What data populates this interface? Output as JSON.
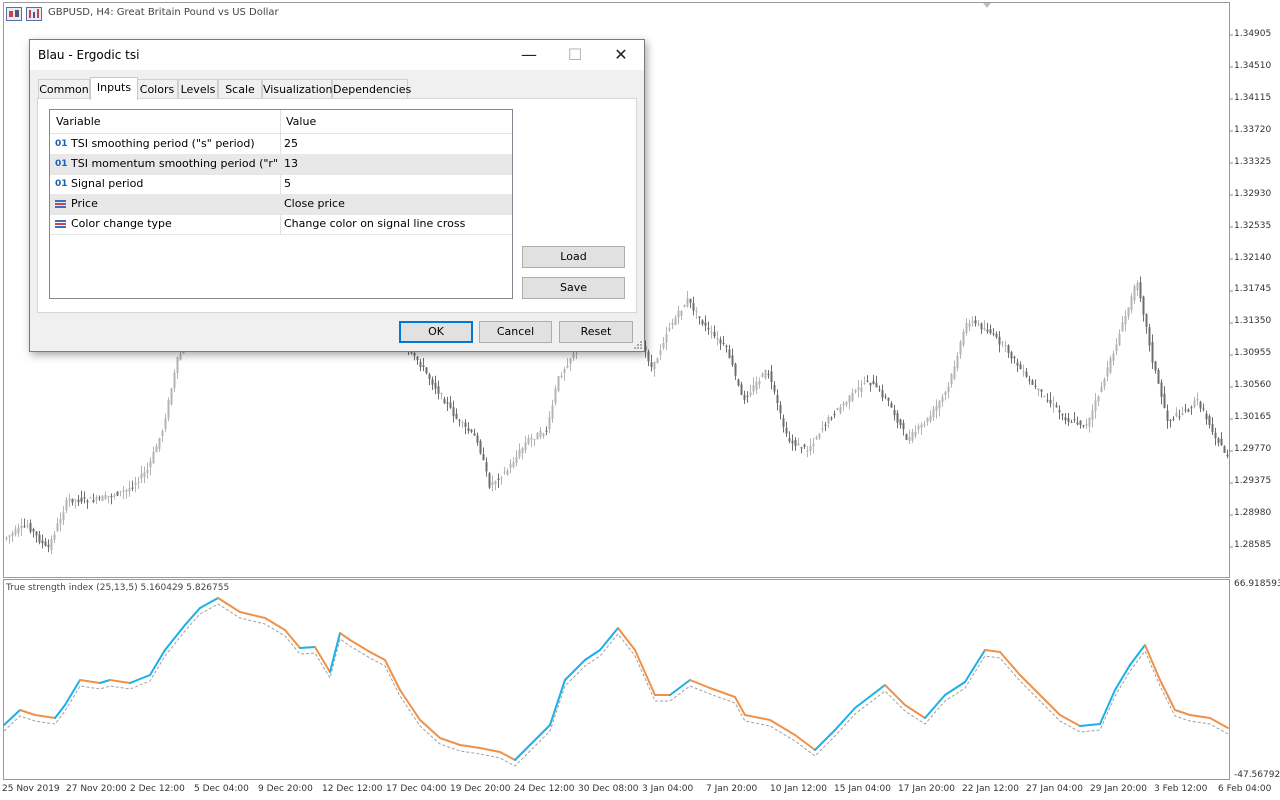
{
  "chart": {
    "symbol_title": "GBPUSD, H4:  Great Britain Pound vs US Dollar",
    "price_labels": [
      "1.34905",
      "1.34510",
      "1.34115",
      "1.33720",
      "1.33325",
      "1.32930",
      "1.32535",
      "1.32140",
      "1.31745",
      "1.31350",
      "1.30955",
      "1.30560",
      "1.30165",
      "1.29770",
      "1.29375",
      "1.28980",
      "1.28585"
    ],
    "indicator_title": "True strength index (25,13,5) 5.160429 5.826755",
    "indicator_max": "66.918593",
    "indicator_min": "-47.567920",
    "date_labels": [
      "25 Nov 2019",
      "27 Nov 20:00",
      "2 Dec 12:00",
      "5 Dec 04:00",
      "9 Dec 20:00",
      "12 Dec 12:00",
      "17 Dec 04:00",
      "19 Dec 20:00",
      "24 Dec 12:00",
      "30 Dec 08:00",
      "3 Jan 04:00",
      "7 Jan 20:00",
      "10 Jan 12:00",
      "15 Jan 04:00",
      "17 Jan 20:00",
      "22 Jan 12:00",
      "27 Jan 04:00",
      "29 Jan 20:00",
      "3 Feb 12:00",
      "6 Feb 04:00"
    ],
    "colors": {
      "tsi_up": "#1ab0e8",
      "tsi_down": "#f0914a",
      "signal": "#a0a0a0",
      "candle_bull": "#b4b4b4",
      "candle_bear": "#6e6e6e"
    }
  },
  "dialog": {
    "title": "Blau - Ergodic tsi",
    "window_buttons": {
      "minimize": "—",
      "maximize": "☐",
      "close": "✕"
    },
    "tabs": [
      "Common",
      "Inputs",
      "Colors",
      "Levels",
      "Scale",
      "Visualization",
      "Dependencies"
    ],
    "active_tab": "Inputs",
    "grid": {
      "headers": [
        "Variable",
        "Value"
      ],
      "rows": [
        {
          "type_icon": "01",
          "variable": "TSI smoothing period (\"s\" period)",
          "value": "25"
        },
        {
          "type_icon": "01",
          "variable": "TSI momentum smoothing period  (\"r\" pe...",
          "value": "13"
        },
        {
          "type_icon": "01",
          "variable": "Signal period",
          "value": "5"
        },
        {
          "type_icon": "enum",
          "variable": "Price",
          "value": "Close price"
        },
        {
          "type_icon": "enum",
          "variable": "Color change type",
          "value": "Change color on signal line cross"
        }
      ]
    },
    "buttons": {
      "load": "Load",
      "save": "Save",
      "ok": "OK",
      "cancel": "Cancel",
      "reset": "Reset"
    }
  }
}
